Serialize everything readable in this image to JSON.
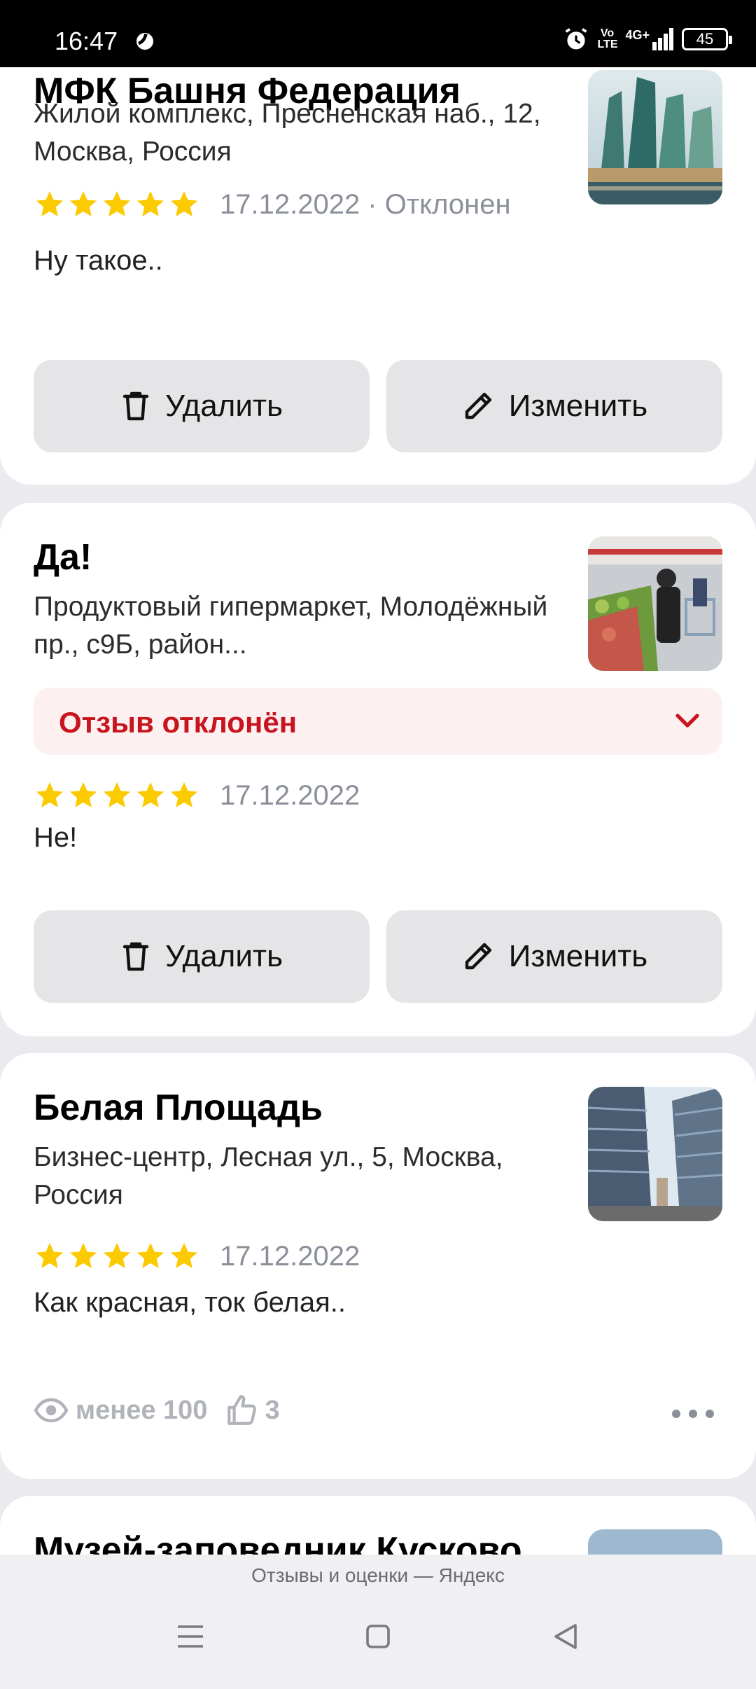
{
  "status_bar": {
    "time": "16:47",
    "network": "4G+",
    "volte": "Vo LTE",
    "battery": "45"
  },
  "reviews": [
    {
      "title": "МФК Башня Федерация",
      "address": "Жилой комплекс, Пресненская наб., 12, Москва, Россия",
      "stars": 5,
      "date": "17.12.2022 · Отклонен",
      "text": "Ну такое..",
      "delete_label": "Удалить",
      "edit_label": "Изменить"
    },
    {
      "title": "Да!",
      "address": "Продуктовый гипермаркет, Молодёжный пр., с9Б, район...",
      "rejected_label": "Отзыв отклонён",
      "stars": 5,
      "date": "17.12.2022",
      "text": "Не!",
      "delete_label": "Удалить",
      "edit_label": "Изменить"
    },
    {
      "title": "Белая Площадь",
      "address": "Бизнес-центр, Лесная ул., 5, Москва, Россия",
      "stars": 5,
      "date": "17.12.2022",
      "text": "Как красная, ток белая..",
      "views": "менее 100",
      "likes": "3"
    },
    {
      "title": "Музей-заповедник Кусково"
    }
  ],
  "footer": {
    "label": "Отзывы и оценки — Яндекс"
  },
  "colors": {
    "star": "#fcca00",
    "rejected": "#c8141e",
    "button_bg": "#e5e5e7",
    "page_bg": "#ebebef"
  }
}
